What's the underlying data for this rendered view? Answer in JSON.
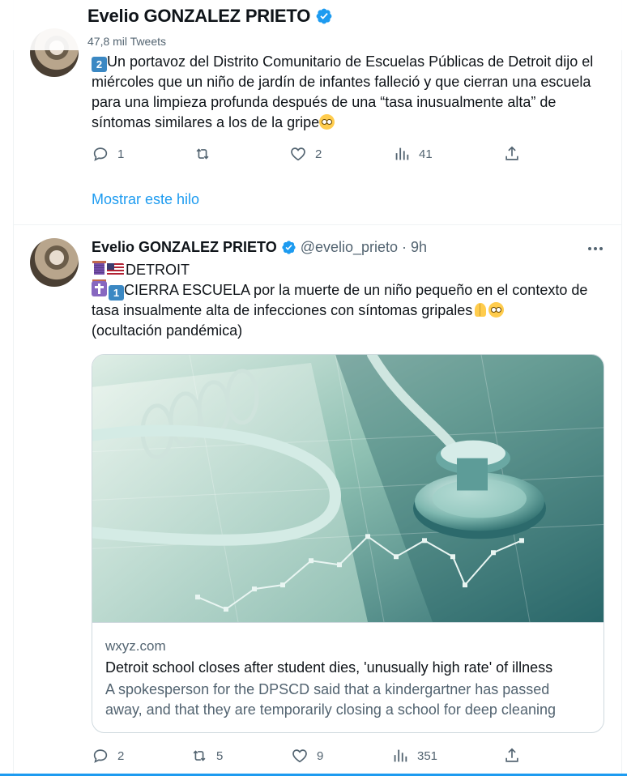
{
  "header": {
    "display_name": "Evelio GONZALEZ PRIETO",
    "tweet_count": "47,8 mil Tweets"
  },
  "tweet1": {
    "number_emoji": "2",
    "text": "Un portavoz del Distrito Comunitario de Escuelas Públicas de Detroit dijo el miércoles que un niño de jardín de infantes falleció y que cierran una escuela para una limpieza profunda después de una “tasa inusualmente alta” de síntomas similares a los de la gripe",
    "replies": "1",
    "retweets": "",
    "likes": "2",
    "views": "41",
    "show_thread": "Mostrar este hilo"
  },
  "tweet2": {
    "display_name": "Evelio GONZALEZ PRIETO",
    "handle": "@evelio_prieto",
    "separator": "·",
    "time": "9h",
    "line1": "DETROIT",
    "number_emoji": "1",
    "line2": "CIERRA ESCUELA por la muerte de un niño pequeño en el contexto de tasa insualmente alta de infecciones con síntomas gripales",
    "line3": "(ocultación pandémica)",
    "card": {
      "domain": "wxyz.com",
      "title": "Detroit school closes after student dies, 'unusually high rate' of illness",
      "desc_line1": "A spokesperson for the DPSCD said that a kindergartner has passed",
      "desc_line2": "away, and that they are temporarily closing a school for deep cleaning"
    },
    "replies": "2",
    "retweets": "5",
    "likes": "9",
    "views": "351"
  },
  "icons": {
    "verified": "verified-badge-icon",
    "reply": "reply-icon",
    "retweet": "retweet-icon",
    "like": "heart-icon",
    "views": "views-bar-chart-icon",
    "share": "share-icon",
    "more": "more-dots-icon"
  },
  "colors": {
    "accent": "#1d9bf0",
    "secondary_text": "#536471",
    "border": "#cfd9de"
  }
}
